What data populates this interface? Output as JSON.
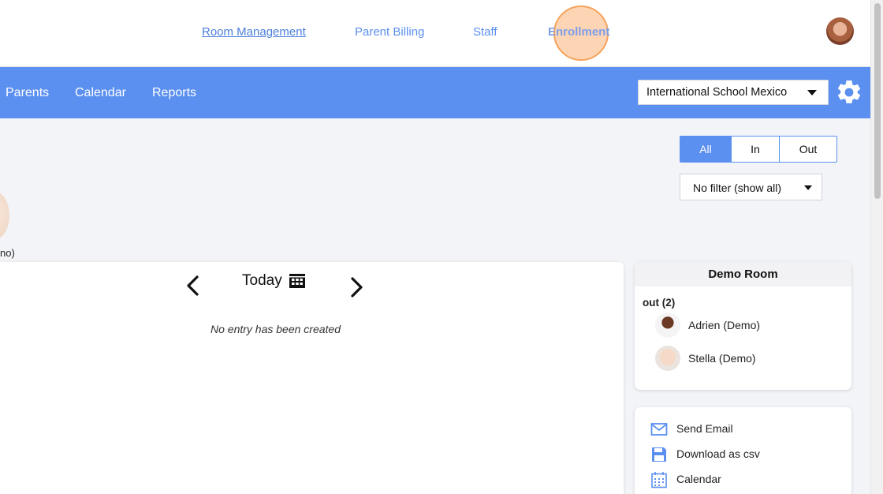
{
  "top_nav": {
    "room_management": "Room Management",
    "parent_billing": "Parent Billing",
    "staff": "Staff",
    "enrollment": "Enrollment"
  },
  "main_nav": {
    "parents": "Parents",
    "calendar": "Calendar",
    "reports": "Reports"
  },
  "school_select": {
    "value": "International School Mexico"
  },
  "status_filter": {
    "all": "All",
    "in": "In",
    "out": "Out",
    "selected": "All"
  },
  "child_filter": {
    "value": "No filter (show all)"
  },
  "partial_child": {
    "label": "no)"
  },
  "day_nav": {
    "label": "Today",
    "empty_message": "No entry has been created"
  },
  "room": {
    "title": "Demo Room",
    "out_label": "out (2)",
    "children": [
      {
        "name": "Adrien (Demo)"
      },
      {
        "name": "Stella (Demo)"
      }
    ]
  },
  "actions": {
    "send_email": "Send Email",
    "download_csv": "Download as csv",
    "calendar": "Calendar"
  },
  "colors": {
    "accent": "#5b8ff0",
    "background": "#f3f4f8",
    "click_highlight": "#f5a35c"
  }
}
